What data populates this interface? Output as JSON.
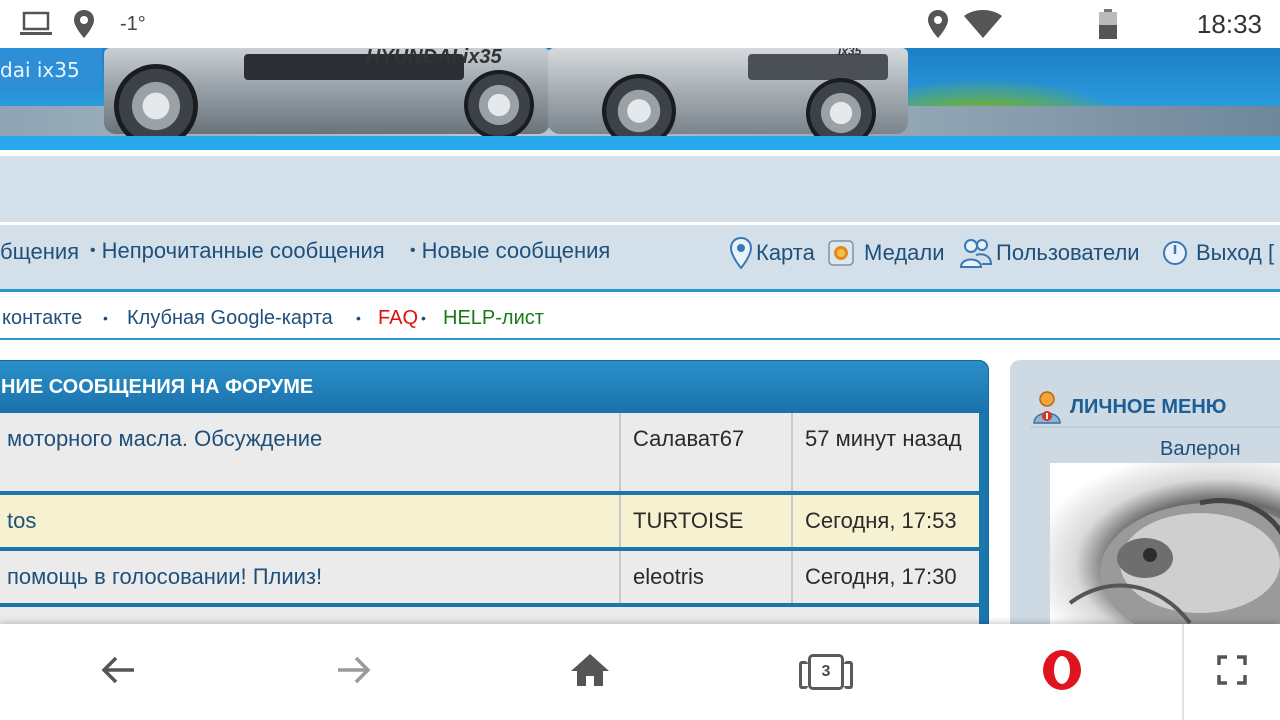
{
  "status_bar": {
    "temperature": "-1°",
    "time": "18:33",
    "icons": [
      "laptop-icon",
      "location-pin-icon",
      "location-pin-icon",
      "wifi-icon",
      "battery-icon"
    ]
  },
  "banner": {
    "model_tag": "dai ix35",
    "car_badge": "HYUNDAI ix35",
    "car_badge_2": "ix35"
  },
  "nav": {
    "item_partial": "бщения",
    "unread_label": "Непрочитанные сообщения",
    "new_label": "Новые сообщения",
    "map_label": "Карта",
    "medals_label": "Медали",
    "users_label": "Пользователи",
    "logout_label": "Выход [",
    "bullet": "•"
  },
  "links": {
    "vk": "контакте",
    "google_map": "Клубная Google-карта",
    "faq": "FAQ",
    "help": "HELP-лист",
    "bullet": "•",
    "faq_color": "#e01010",
    "help_color": "#1a7a1a"
  },
  "posts": {
    "title": "НИЕ СООБЩЕНИЯ НА ФОРУМЕ",
    "rows": [
      {
        "title": "моторного масла. Обсуждение",
        "author": "Салават67",
        "date": "57 минут назад"
      },
      {
        "title": "tos",
        "author": "TURTOISE",
        "date": "Сегодня, 17:53"
      },
      {
        "title": "помощь в голосовании! Плииз!",
        "author": "eleotris",
        "date": "Сегодня, 17:30"
      }
    ]
  },
  "sidebar": {
    "title": "ЛИЧНОЕ МЕНЮ",
    "username": "Валерон"
  },
  "browser_bar": {
    "tab_count": "3",
    "accent_color": "#e0141e"
  }
}
